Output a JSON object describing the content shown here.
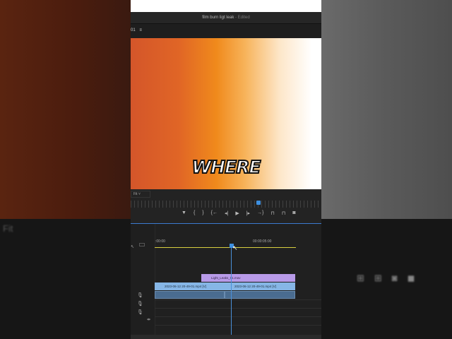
{
  "window": {
    "title": "film burn ligt leak",
    "status": "- Edited"
  },
  "panel": {
    "label": "01",
    "menu_icon": "hamburger-icon"
  },
  "caption": "WHERE",
  "monitor": {
    "zoom": "Fit"
  },
  "transport": {
    "buttons": [
      "marker",
      "mark-in",
      "mark-out",
      "go-to-in",
      "step-back",
      "play",
      "step-forward",
      "go-to-out",
      "lift",
      "extract",
      "export-frame"
    ]
  },
  "timeline": {
    "timecodes": [
      ":00:00",
      "00:00:05:00"
    ],
    "clips": {
      "v2": "Light_Leaks_01.mov",
      "v1a": "2023-06-12 20-49-01.mp4 [V]",
      "v1b": "2023-06-12 20-49-01.mp4 [V]"
    }
  },
  "side": {
    "fit": "Fit"
  },
  "colors": {
    "accent": "#3d8fe0",
    "video_clip": "#86b6e6",
    "adjust_clip": "#b89ae8",
    "work_area": "#d8d040"
  }
}
